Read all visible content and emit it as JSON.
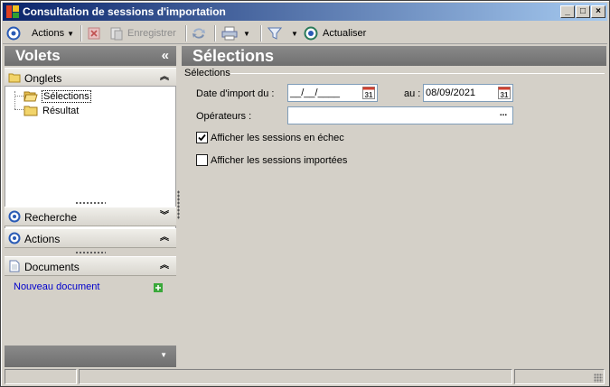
{
  "window": {
    "title": "Consultation de sessions d'importation"
  },
  "toolbar": {
    "actions_label": "Actions",
    "save_label": "Enregistrer",
    "refresh_label": "Actualiser"
  },
  "left": {
    "header": "Volets",
    "collapse_glyph": "«",
    "onglets_label": "Onglets",
    "tree": [
      "Sélections",
      "Résultat"
    ],
    "recherche_label": "Recherche",
    "actions_label": "Actions",
    "documents_label": "Documents",
    "new_doc_label": "Nouveau document"
  },
  "main": {
    "header": "Sélections",
    "group_label": "Sélections",
    "date_import_label": "Date d'import du :",
    "date_from_value": "__/__/____",
    "date_to_label": "au :",
    "date_to_value": "08/09/2021",
    "calendar_day": "31",
    "operators_label": "Opérateurs :",
    "operators_value": "",
    "ellipsis": "...",
    "check_failed_label": "Afficher les sessions en échec",
    "check_failed": true,
    "check_imported_label": "Afficher les sessions importées",
    "check_imported": false
  },
  "colors": {
    "title_start": "#0a246a",
    "title_end": "#a6caf0",
    "panel_header": "#7a7a7a",
    "link": "#0000cc"
  }
}
